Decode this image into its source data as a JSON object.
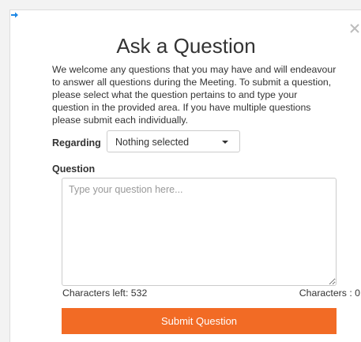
{
  "dialog": {
    "title": "Ask a Question",
    "intro": "We welcome any questions that you may have and will endeavour to answer all questions during the Meeting. To submit a question, please select what the question pertains to and type your question in the provided area. If you have multiple questions please submit each individually.",
    "close_icon": "close-icon",
    "corner_icon": "arrow-right-icon"
  },
  "form": {
    "regarding_label": "Regarding",
    "regarding_value": "Nothing selected",
    "question_label": "Question",
    "question_placeholder": "Type your question here...",
    "question_value": "",
    "chars_left": "Characters left: 532",
    "chars_count": "Characters : 0",
    "submit_label": "Submit Question"
  },
  "colors": {
    "accent": "#f26b25",
    "corner_icon": "#1e88e5"
  }
}
